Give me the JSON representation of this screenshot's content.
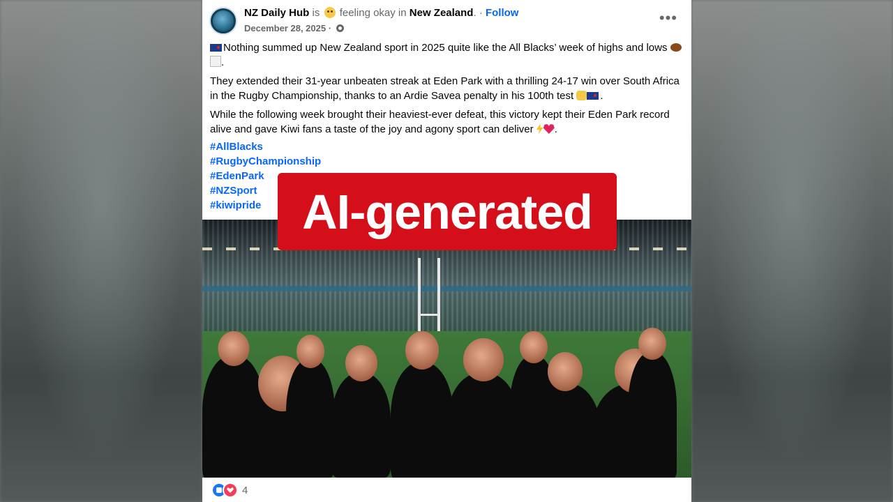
{
  "post": {
    "page_name": "NZ Daily Hub",
    "is_text": "is",
    "feeling": "feeling okay in",
    "location": "New Zealand",
    "follow_label": "Follow",
    "date": "December 28, 2025",
    "paragraph1": "Nothing summed up New Zealand sport in 2025 quite like the All Blacks’ week of highs and lows",
    "paragraph2": "They extended their 31-year unbeaten streak at Eden Park with a thrilling 24-17 win over South Africa in the Rugby Championship, thanks to an Ardie Savea penalty in his 100th test",
    "paragraph3": "While the following week brought their heaviest-ever defeat, this victory kept their Eden Park record alive and gave Kiwi fans a taste of the joy and agony sport can deliver",
    "hashtags": [
      "#AllBlacks",
      "#RugbyChampionship",
      "#EdenPark",
      "#NZSport",
      "#kiwipride"
    ],
    "reaction_count": "4"
  },
  "overlay": {
    "label": "AI-generated",
    "color": "#d50f1a"
  },
  "icons": [
    "ellipsis-icon",
    "globe-gear-icon",
    "like-reaction-icon",
    "love-reaction-icon"
  ]
}
